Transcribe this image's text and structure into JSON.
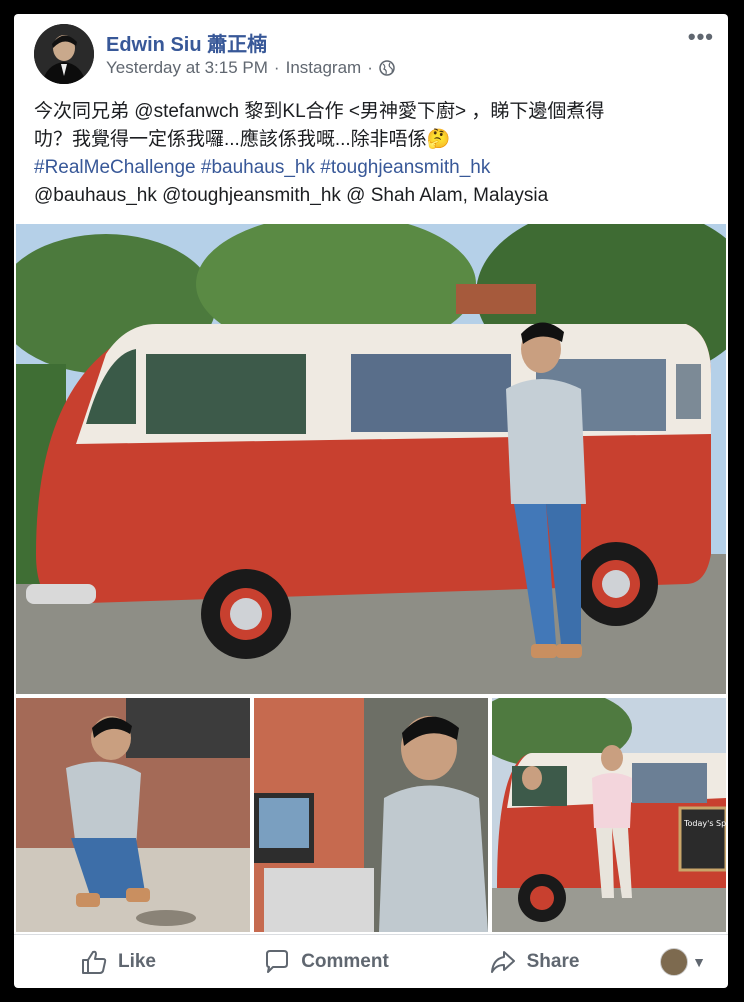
{
  "post": {
    "author": "Edwin Siu 蕭正楠",
    "timestamp": "Yesterday at 3:15 PM",
    "source": "Instagram",
    "separator": "·",
    "more_icon": "more-icon",
    "text_line1": "今次同兄弟 @stefanwch 黎到KL合作 <男神愛下廚> ，睇下邊個煮得",
    "text_line2": "叻？我覺得一定係我囉...應該係我嘅...除非唔係🤔",
    "hashtags": "#RealMeChallenge #bauhaus_hk #toughjeansmith_hk",
    "mentions": "@bauhaus_hk @toughjeansmith_hk @ Shah Alam, Malaysia",
    "chalkboard_text": "Today's Special"
  },
  "actions": {
    "like": "Like",
    "comment": "Comment",
    "share": "Share"
  },
  "colors": {
    "link": "#385898",
    "text": "#1c1e21",
    "meta": "#606770",
    "van_red": "#c8402f",
    "van_white": "#efeae2"
  }
}
